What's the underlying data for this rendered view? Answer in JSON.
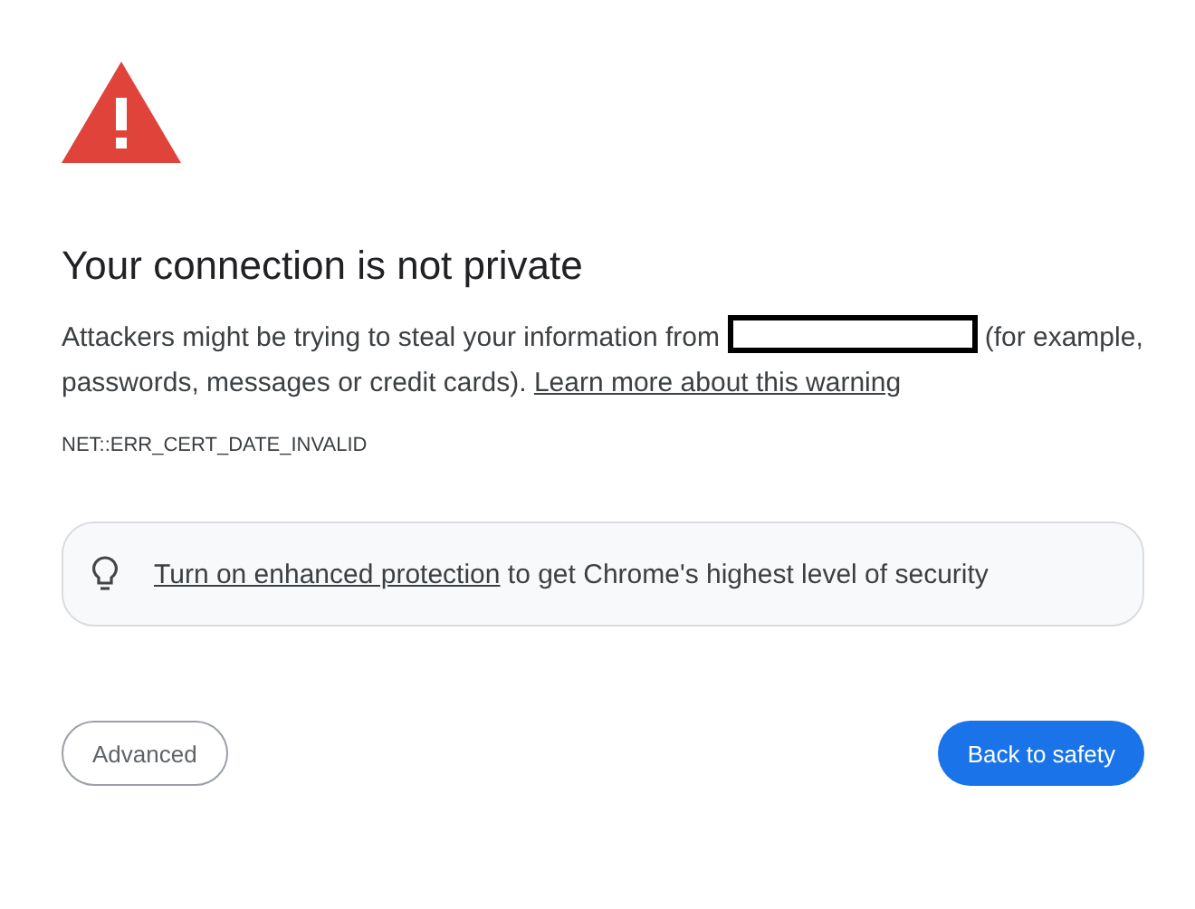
{
  "title": "Your connection is not private",
  "message": {
    "before": "Attackers might be trying to steal your information from",
    "after": "(for example, passwords, messages or credit cards).",
    "link": "Learn more about this warning"
  },
  "error_code": "NET::ERR_CERT_DATE_INVALID",
  "tip": {
    "link": "Turn on enhanced protection",
    "text": "to get Chrome's highest level of security"
  },
  "buttons": [
    {
      "label": "Advanced",
      "kind": "secondary"
    },
    {
      "label": "Back to safety",
      "kind": "primary"
    }
  ]
}
